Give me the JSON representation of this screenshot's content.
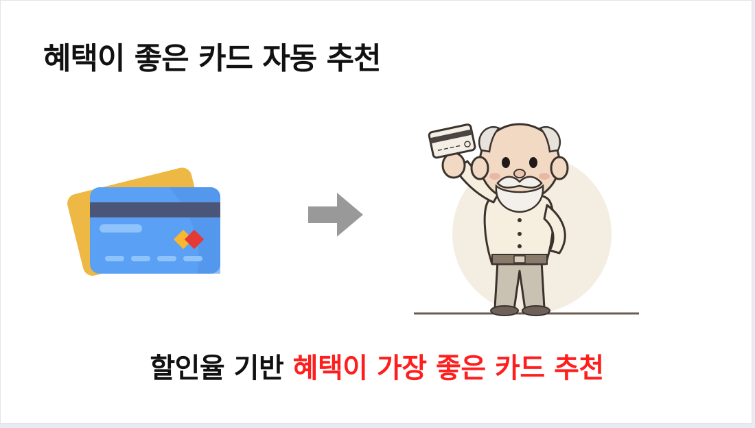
{
  "title": "혜택이 좋은 카드 자동 추천",
  "caption": {
    "plain": "할인율 기반 ",
    "highlight": "혜택이 가장 좋은 카드 추천"
  },
  "colors": {
    "highlight": "#ff1e1e",
    "card_front": "#5aa0f5",
    "card_back": "#f2c04a",
    "arrow": "#999999"
  },
  "icons": {
    "cards": "credit-cards-icon",
    "arrow": "arrow-right-icon",
    "person": "elderly-man-holding-card"
  }
}
